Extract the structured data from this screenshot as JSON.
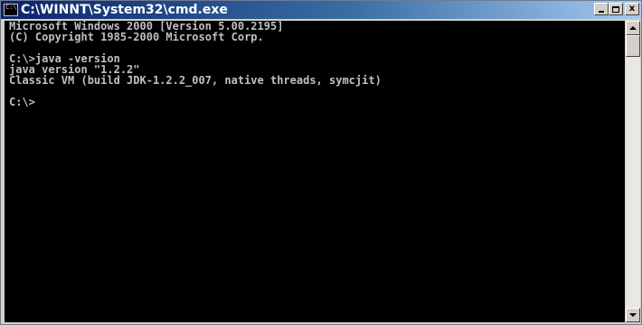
{
  "window": {
    "title": "C:\\WINNT\\System32\\cmd.exe",
    "icon": "console-app-icon",
    "icon_label": "C:\\",
    "controls": {
      "minimize": "minimize-icon",
      "maximize": "maximize-icon",
      "close_label": "x"
    }
  },
  "console": {
    "foreground": "#c0c0c0",
    "background": "#000000",
    "lines": [
      "Microsoft Windows 2000 [Version 5.00.2195]",
      "(C) Copyright 1985-2000 Microsoft Corp.",
      "",
      "C:\\>java -version",
      "java version \"1.2.2\"",
      "Classic VM (build JDK-1.2.2_007, native threads, symcjit)",
      "",
      "C:\\>"
    ]
  },
  "colors": {
    "titlebar_start": "#0a246a",
    "titlebar_end": "#a6caf0",
    "title_text": "#ffffff",
    "chrome": "#d4d0c8"
  }
}
